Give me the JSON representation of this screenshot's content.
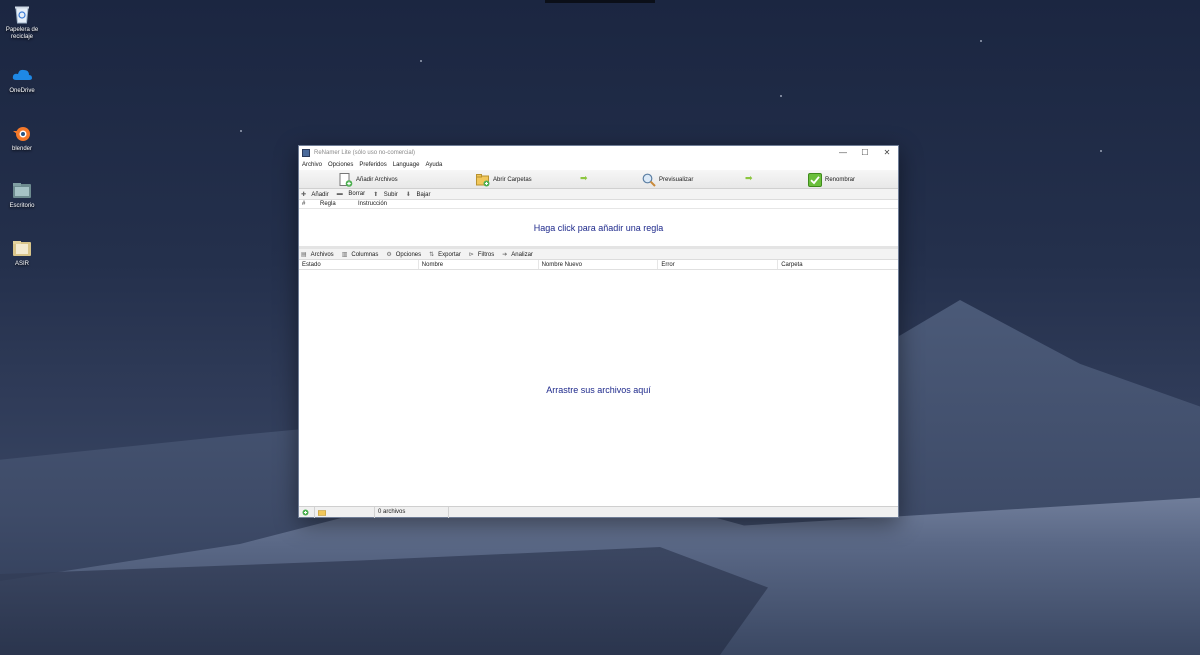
{
  "desktop": {
    "icons": [
      {
        "label": "Papelera de reciclaje",
        "icon": "recycle-bin-icon"
      },
      {
        "label": "OneDrive",
        "icon": "cloud-icon"
      },
      {
        "label": "blender",
        "icon": "blender-icon"
      },
      {
        "label": "Escritorio",
        "icon": "folder-icon"
      },
      {
        "label": "ASIR",
        "icon": "folder-icon"
      }
    ]
  },
  "window": {
    "title": "ReNamer Lite (sólo uso no-comercial)",
    "controls": {
      "minimize": "—",
      "maximize": "☐",
      "close": "✕"
    },
    "menu": [
      "Archivo",
      "Opciones",
      "Preferidos",
      "Language",
      "Ayuda"
    ],
    "toolbar": {
      "add_files": "Añadir Archivos",
      "open_folders": "Abrir Carpetas",
      "preview": "Previsualizar",
      "rename": "Renombrar"
    },
    "rules_toolbar": [
      "Añadir",
      "Borrar",
      "Subir",
      "Bajar"
    ],
    "rules_columns": [
      "#",
      "Regla",
      "Instrucción"
    ],
    "rules_hint": "Haga click para añadir una regla",
    "files_toolbar": [
      "Archivos",
      "Columnas",
      "Opciones",
      "Exportar",
      "Filtros",
      "Analizar"
    ],
    "files_columns": [
      "Estado",
      "Nombre",
      "Nombre Nuevo",
      "Error",
      "Carpeta"
    ],
    "files_hint": "Arrastre sus archivos aquí",
    "status": {
      "count": "0 archivos"
    }
  },
  "colors": {
    "hint_text": "#1f2a8c",
    "arrow_green": "#8cc63f"
  }
}
